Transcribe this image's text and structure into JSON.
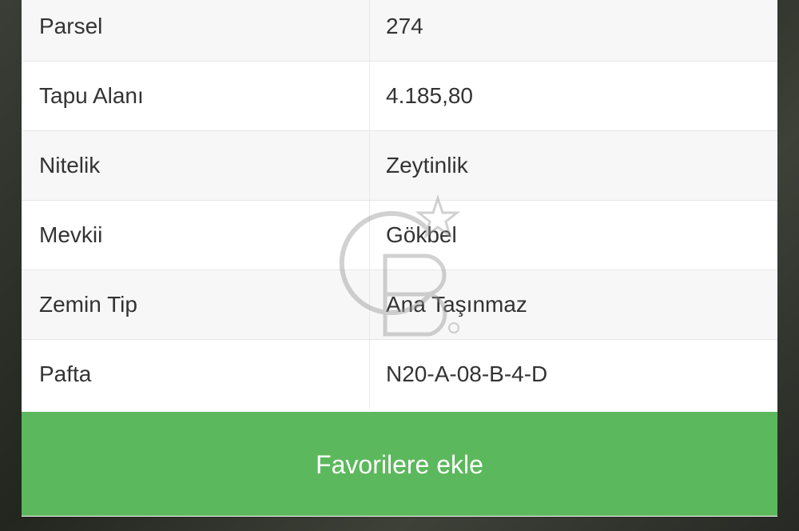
{
  "details": {
    "rows": [
      {
        "label": "Parsel",
        "value": "274"
      },
      {
        "label": "Tapu Alanı",
        "value": "4.185,80"
      },
      {
        "label": "Nitelik",
        "value": "Zeytinlik"
      },
      {
        "label": "Mevkii",
        "value": "Gökbel"
      },
      {
        "label": "Zemin Tip",
        "value": "Ana Taşınmaz"
      },
      {
        "label": "Pafta",
        "value": "N20-A-08-B-4-D"
      }
    ]
  },
  "actions": {
    "favorite_label": "Favorilere ekle"
  },
  "colors": {
    "button_green": "#5cb85c",
    "row_alt": "#f7f7f7"
  },
  "watermark": {
    "icon": "logo-watermark-icon"
  }
}
